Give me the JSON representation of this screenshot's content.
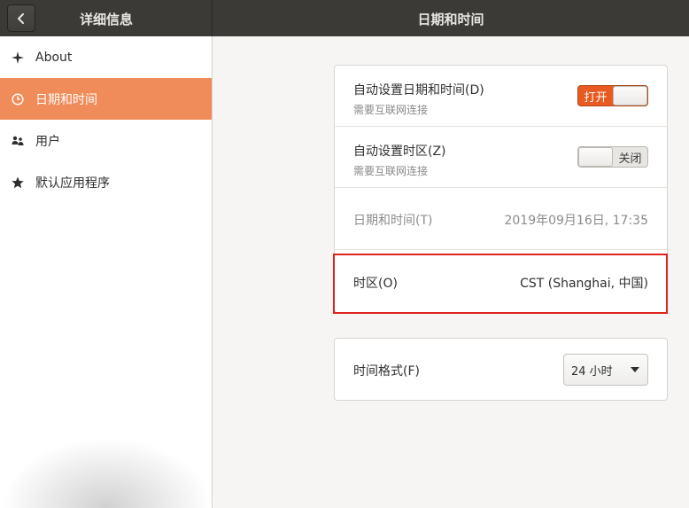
{
  "header": {
    "left_title": "详细信息",
    "right_title": "日期和时间"
  },
  "sidebar": {
    "items": [
      {
        "label": "About",
        "icon": "sparkle-icon",
        "active": false
      },
      {
        "label": "日期和时间",
        "icon": "clock-icon",
        "active": true
      },
      {
        "label": "用户",
        "icon": "users-icon",
        "active": false
      },
      {
        "label": "默认应用程序",
        "icon": "star-icon",
        "active": false
      }
    ]
  },
  "datetime": {
    "auto_datetime": {
      "title": "自动设置日期和时间(D)",
      "subtitle": "需要互联网连接",
      "switch_label": "打开",
      "state": "on"
    },
    "auto_timezone": {
      "title": "自动设置时区(Z)",
      "subtitle": "需要互联网连接",
      "switch_label": "关闭",
      "state": "off"
    },
    "date_time": {
      "title": "日期和时间(T)",
      "value": "2019年09月16日, 17:35"
    },
    "timezone": {
      "title": "时区(O)",
      "value": "CST (Shanghai, 中国)"
    }
  },
  "format": {
    "title": "时间格式(F)",
    "selected": "24 小时"
  },
  "colors": {
    "accent": "#f08b5a",
    "switch_on": "#e95a20",
    "highlight": "#e0231c",
    "header": "#3b3a37"
  }
}
